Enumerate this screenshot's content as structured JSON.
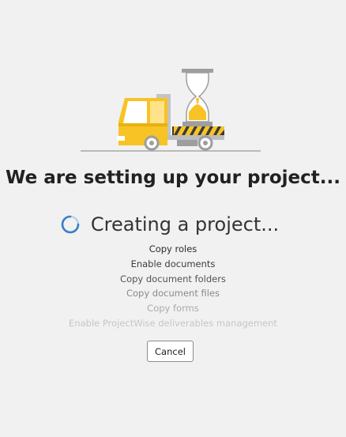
{
  "headline": "We are setting up your project...",
  "status": {
    "text": "Creating a project...",
    "icon": "loading-spinner-icon"
  },
  "steps": [
    {
      "label": "Copy roles",
      "color": "#2b2b2b"
    },
    {
      "label": "Enable documents",
      "color": "#3d3d3d"
    },
    {
      "label": "Copy document folders",
      "color": "#545454"
    },
    {
      "label": "Copy document files",
      "color": "#8a8a8a"
    },
    {
      "label": "Copy forms",
      "color": "#ababab"
    },
    {
      "label": "Enable ProjectWise deliverables management",
      "color": "#c6c6c6"
    }
  ],
  "cancel_label": "Cancel",
  "colors": {
    "background": "#f1f1f1",
    "accent": "#f7c325",
    "spinner": "#3b7fc4"
  }
}
